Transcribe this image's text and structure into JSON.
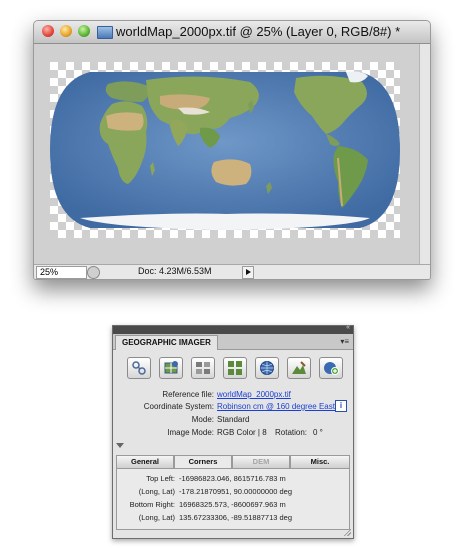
{
  "document_window": {
    "title": "worldMap_2000px.tif @ 25% (Layer 0, RGB/8#) *",
    "zoom": "25%",
    "doc_size": "Doc: 4.23M/6.53M"
  },
  "panel": {
    "tab": "GEOGRAPHIC IMAGER",
    "collapse_glyph": "«",
    "menu_glyph": "▾≡",
    "tools": [
      {
        "icon": "georeference-icon"
      },
      {
        "icon": "transform-icon"
      },
      {
        "icon": "mosaic-icon"
      },
      {
        "icon": "tile-icon"
      },
      {
        "icon": "globe-projection-icon"
      },
      {
        "icon": "terrain-shader-icon"
      },
      {
        "icon": "import-icon"
      }
    ],
    "info": {
      "reference_file_label": "Reference file:",
      "reference_file_value": "worldMap_2000px.tif",
      "coord_system_label": "Coordinate System:",
      "coord_system_value": "Robinson cm @ 160 degree East",
      "mode_label": "Mode:",
      "mode_value": "Standard",
      "image_mode_label": "Image Mode:",
      "image_mode_value": "RGB Color  |  8",
      "rotation_label": "Rotation:",
      "rotation_value": "0 °",
      "info_glyph": "i"
    },
    "tabs": [
      {
        "label": "General",
        "active": false,
        "disabled": false
      },
      {
        "label": "Corners",
        "active": true,
        "disabled": false
      },
      {
        "label": "DEM",
        "active": false,
        "disabled": true
      },
      {
        "label": "Misc.",
        "active": false,
        "disabled": false
      }
    ],
    "corners": {
      "top_left_label": "Top Left:",
      "top_left_value": "-16986823.046, 8615716.783 m",
      "top_left_latlong_label": "(Long, Lat)",
      "top_left_latlong_value": "-178.21870951, 90.00000000 deg",
      "bottom_right_label": "Bottom Right:",
      "bottom_right_value": "16968325.573, -8600697.963 m",
      "bottom_right_latlong_label": "(Long, Lat)",
      "bottom_right_latlong_value": "135.67233306, -89.51887713 deg"
    }
  },
  "colors": {
    "ocean": "#5b86ba",
    "land": "#8aa65a",
    "desert": "#cdb27e",
    "ice": "#f2f4f6",
    "link": "#1a3fd4"
  }
}
